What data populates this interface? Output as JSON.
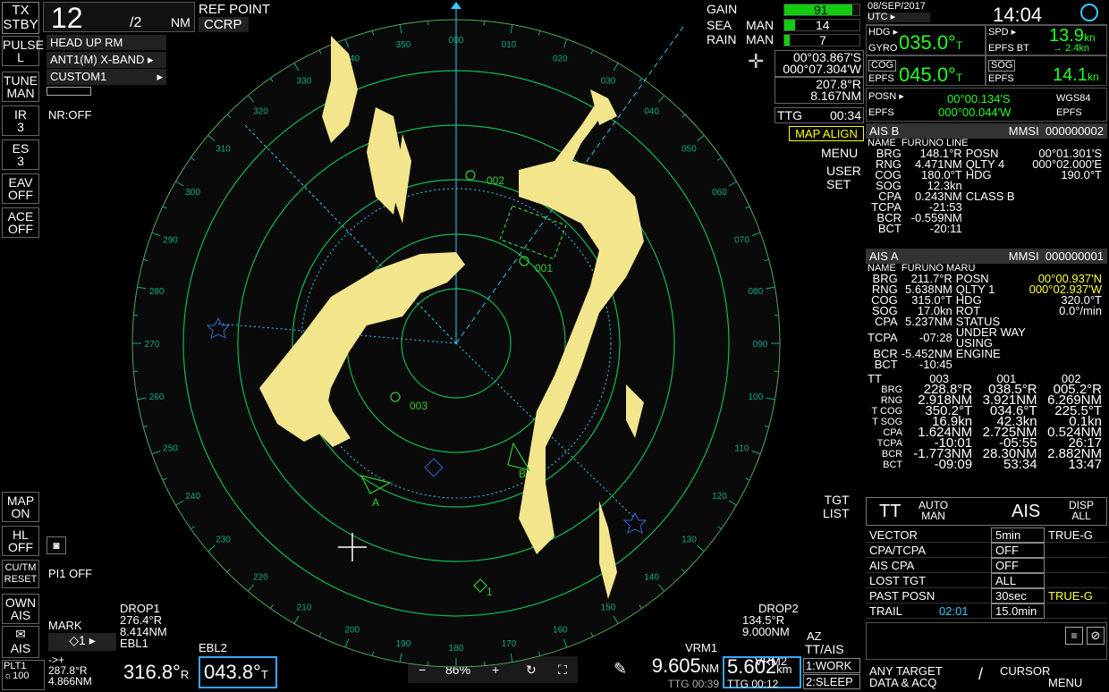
{
  "status": {
    "tx": "TX",
    "stby": "STBY",
    "range": "12",
    "range_ring": "/2",
    "range_unit": "NM",
    "ref_point_label": "REF POINT",
    "ref_point": "CCRP"
  },
  "left_buttons": [
    {
      "a": "PULSE",
      "b": "L"
    },
    {
      "a": "TUNE",
      "b": "MAN"
    },
    {
      "a": "IR",
      "b": "3"
    },
    {
      "a": "ES",
      "b": "3"
    },
    {
      "a": "EAV",
      "b": "OFF"
    },
    {
      "a": "ACE",
      "b": "OFF"
    }
  ],
  "mode": {
    "presentation": "HEAD UP RM",
    "antenna": "ANT1(M) X-BAND",
    "custom": "CUSTOM1",
    "nr": "NR:OFF"
  },
  "left_lower": [
    {
      "a": "MAP",
      "b": "ON"
    },
    {
      "a": "HL",
      "b": "OFF"
    },
    {
      "a": "CU/TM",
      "b": "RESET"
    },
    {
      "a": "OWN",
      "b": "AIS"
    }
  ],
  "pi": "PI1 OFF",
  "mark": {
    "label": "MARK",
    "symbol": "◇1"
  },
  "ais_btn": "AIS",
  "plt": {
    "label": "PLT1",
    "icon": "☼100",
    "arrow": "->+",
    "brg": "287.8°R",
    "rng": "4.866NM"
  },
  "drop1": {
    "title": "DROP1",
    "brg": "276.4°R",
    "rng": "8.414NM"
  },
  "drop2": {
    "title": "DROP2",
    "brg": "134.5°R",
    "rng": "9.000NM"
  },
  "ebl1": {
    "label": "EBL1",
    "value": "316.8°",
    "suffix": "R"
  },
  "ebl2": {
    "label": "EBL2",
    "value": "043.8°",
    "suffix": "T"
  },
  "zoom": {
    "minus": "−",
    "value": "86%",
    "plus": "+"
  },
  "vrm1": {
    "label": "VRM1",
    "value": "9.605",
    "unit": "NM",
    "ttg": "TTG 00:39"
  },
  "vrm2": {
    "label": "VRM2",
    "value": "5.602",
    "unit": "km",
    "ttg": "TTG 00:12"
  },
  "az": {
    "label": "AZ",
    "title": "TT/AIS",
    "work": "1:WORK",
    "sleep": "2:SLEEP"
  },
  "gain": {
    "gain_label": "GAIN",
    "gain": "91",
    "gain_level": 0.91,
    "sea_label": "SEA",
    "sea_mode": "MAN",
    "sea": "14",
    "sea_level": 0.14,
    "rain_label": "RAIN",
    "rain_mode": "MAN",
    "rain": "7",
    "rain_level": 0.07
  },
  "cursor": {
    "lat": "00°03.867'S",
    "lon": "000°07.304'W",
    "brg": "207.8°R",
    "rng": "8.167NM",
    "ttg_label": "TTG",
    "ttg": "00:34"
  },
  "map_align": "MAP ALIGN",
  "menu_btn": "MENU",
  "user_set": {
    "a": "USER",
    "b": "SET"
  },
  "tgt_list": {
    "a": "TGT",
    "b": "LIST"
  },
  "header": {
    "date": "08/SEP/2017",
    "utc": "UTC",
    "time": "14:04"
  },
  "hdg": {
    "label": "HDG",
    "src": "GYRO",
    "value": "035.0°",
    "unit": "T"
  },
  "spd": {
    "label": "SPD",
    "src": "EPFS BT",
    "value": "13.9",
    "unit": "kn",
    "arrow": "→",
    "sub": "2.4",
    "sub_unit": "kn"
  },
  "cog": {
    "label": "COG",
    "src": "EPFS",
    "value": "045.0°",
    "unit": "T"
  },
  "sog": {
    "label": "SOG",
    "src": "EPFS",
    "value": "14.1",
    "unit": "kn"
  },
  "posn": {
    "label": "POSN",
    "src": "EPFS",
    "lat": "00°00.134'S",
    "lon": "000°00.044'W",
    "datum": "WGS84",
    "datum_src": "EPFS"
  },
  "ais_b": {
    "title": "AIS B",
    "mmsi_label": "MMSI",
    "mmsi": "000000002",
    "name_label": "NAME",
    "name": "FURUNO LINE",
    "rows": [
      [
        "BRG",
        "148.1°R",
        "POSN",
        "00°01.301'S"
      ],
      [
        "RNG",
        "4.471NM",
        "QLTY 4",
        "000°02.000'E"
      ],
      [
        "COG",
        "180.0°T",
        "HDG",
        "190.0°T"
      ],
      [
        "SOG",
        "12.3kn",
        "",
        ""
      ],
      [
        "CPA",
        "0.243NM",
        "CLASS B",
        ""
      ],
      [
        "TCPA",
        "-21:53",
        "",
        ""
      ],
      [
        "BCR",
        "-0.559NM",
        "",
        ""
      ],
      [
        "BCT",
        "-20:11",
        "",
        ""
      ]
    ]
  },
  "ais_a": {
    "title": "AIS A",
    "mmsi_label": "MMSI",
    "mmsi": "000000001",
    "name_label": "NAME",
    "name": "FURUNO MARU",
    "rows": [
      [
        "BRG",
        "211.7°R",
        "POSN",
        "00°00.937'N"
      ],
      [
        "RNG",
        "5.638NM",
        "QLTY 1",
        "000°02.937'W"
      ],
      [
        "COG",
        "315.0°T",
        "HDG",
        "320.0°T"
      ],
      [
        "SOG",
        "17.0kn",
        "ROT",
        "0.0°/min"
      ],
      [
        "CPA",
        "5.237NM",
        "STATUS",
        ""
      ],
      [
        "TCPA",
        "-07:28",
        "UNDER WAY USING",
        ""
      ],
      [
        "BCR",
        "-5.452NM",
        "ENGINE",
        ""
      ],
      [
        "BCT",
        "-10:45",
        "",
        ""
      ]
    ]
  },
  "tt": {
    "title": "TT",
    "ids": [
      "003",
      "001",
      "002"
    ],
    "rows": [
      [
        "BRG",
        "228.8°R",
        "038.5°R",
        "005.2°R"
      ],
      [
        "RNG",
        "2.918NM",
        "3.921NM",
        "6.269NM"
      ],
      [
        "T COG",
        "350.2°T",
        "034.6°T",
        "225.5°T"
      ],
      [
        "T SOG",
        "16.9kn",
        "42.3kn",
        "0.1kn"
      ],
      [
        "CPA",
        "1.624NM",
        "2.725NM",
        "0.524NM"
      ],
      [
        "TCPA",
        "-10:01",
        "-05:55",
        "26:17"
      ],
      [
        "BCR",
        "-1.773NM",
        "28.30NM",
        "2.882NM"
      ],
      [
        "BCT",
        "-09:09",
        "53:34",
        "13:47"
      ]
    ]
  },
  "tt_ctrl": {
    "tt": "TT",
    "auto": "AUTO",
    "man": "MAN",
    "ais": "AIS",
    "disp": "DISP",
    "all": "ALL"
  },
  "settings": [
    {
      "label": "VECTOR",
      "value": "5min",
      "extra": "TRUE-G"
    },
    {
      "label": "CPA/TCPA",
      "value": "OFF",
      "extra": ""
    },
    {
      "label": "AIS CPA",
      "value": "OFF",
      "extra": ""
    },
    {
      "label": "LOST TGT",
      "value": "ALL",
      "extra": ""
    },
    {
      "label": "PAST POSN",
      "value": "30sec",
      "extra": "TRUE-G"
    },
    {
      "label": "TRAIL",
      "value": "15.0min",
      "extra": "02:01"
    }
  ],
  "bottom_right": {
    "a1": "ANY TARGET",
    "a2": "DATA & ACQ",
    "slash": "/",
    "b1": "CURSOR",
    "b2": "MENU"
  },
  "targets": {
    "t002": "002",
    "t001": "001",
    "t003": "003",
    "tA": "A",
    "tB": "B",
    "m1": "1"
  },
  "bearing_labels": [
    "000",
    "010",
    "020",
    "030",
    "040",
    "050",
    "060",
    "070",
    "080",
    "090",
    "100",
    "110",
    "120",
    "130",
    "140",
    "150",
    "160",
    "170",
    "180",
    "190",
    "200",
    "210",
    "220",
    "230",
    "240",
    "250",
    "260",
    "270",
    "280",
    "290",
    "300",
    "310",
    "320",
    "330",
    "340",
    "350"
  ]
}
